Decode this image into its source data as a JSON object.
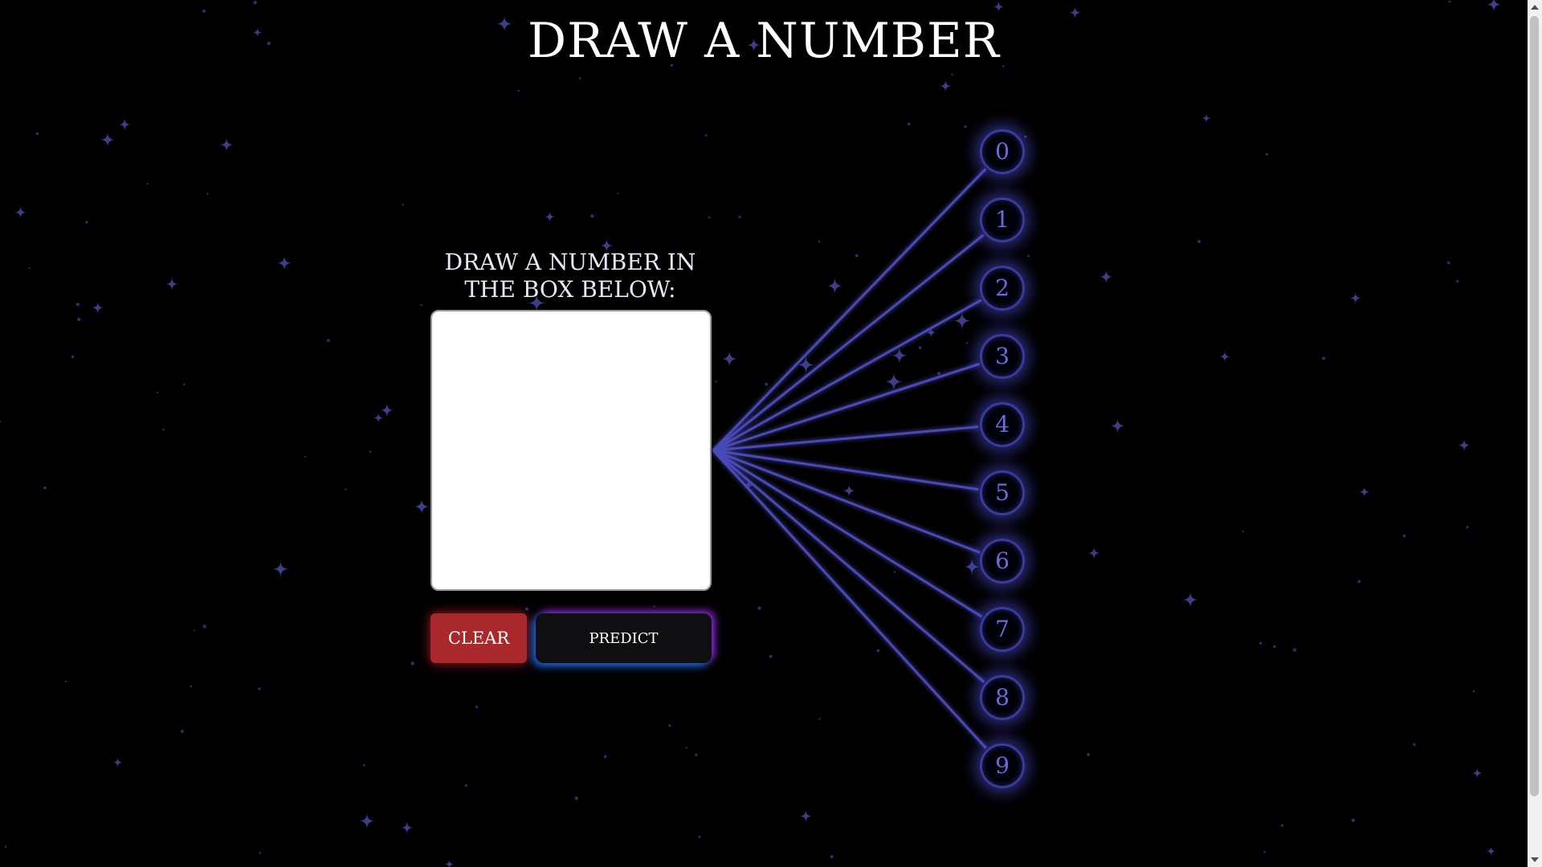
{
  "page": {
    "title": "DRAW A NUMBER",
    "instruction": "DRAW A NUMBER IN THE BOX BELOW:"
  },
  "controls": {
    "clear_label": "CLEAR",
    "predict_label": "PREDICT"
  },
  "output_nodes": [
    "0",
    "1",
    "2",
    "3",
    "4",
    "5",
    "6",
    "7",
    "8",
    "9"
  ],
  "colors": {
    "background": "#000000",
    "node_glow": "#5050e6",
    "connection_line": "#4a4ab8",
    "clear_button": "#a8282c",
    "predict_glow_left": "#1e78ff",
    "predict_glow_right": "#aa28f0"
  }
}
